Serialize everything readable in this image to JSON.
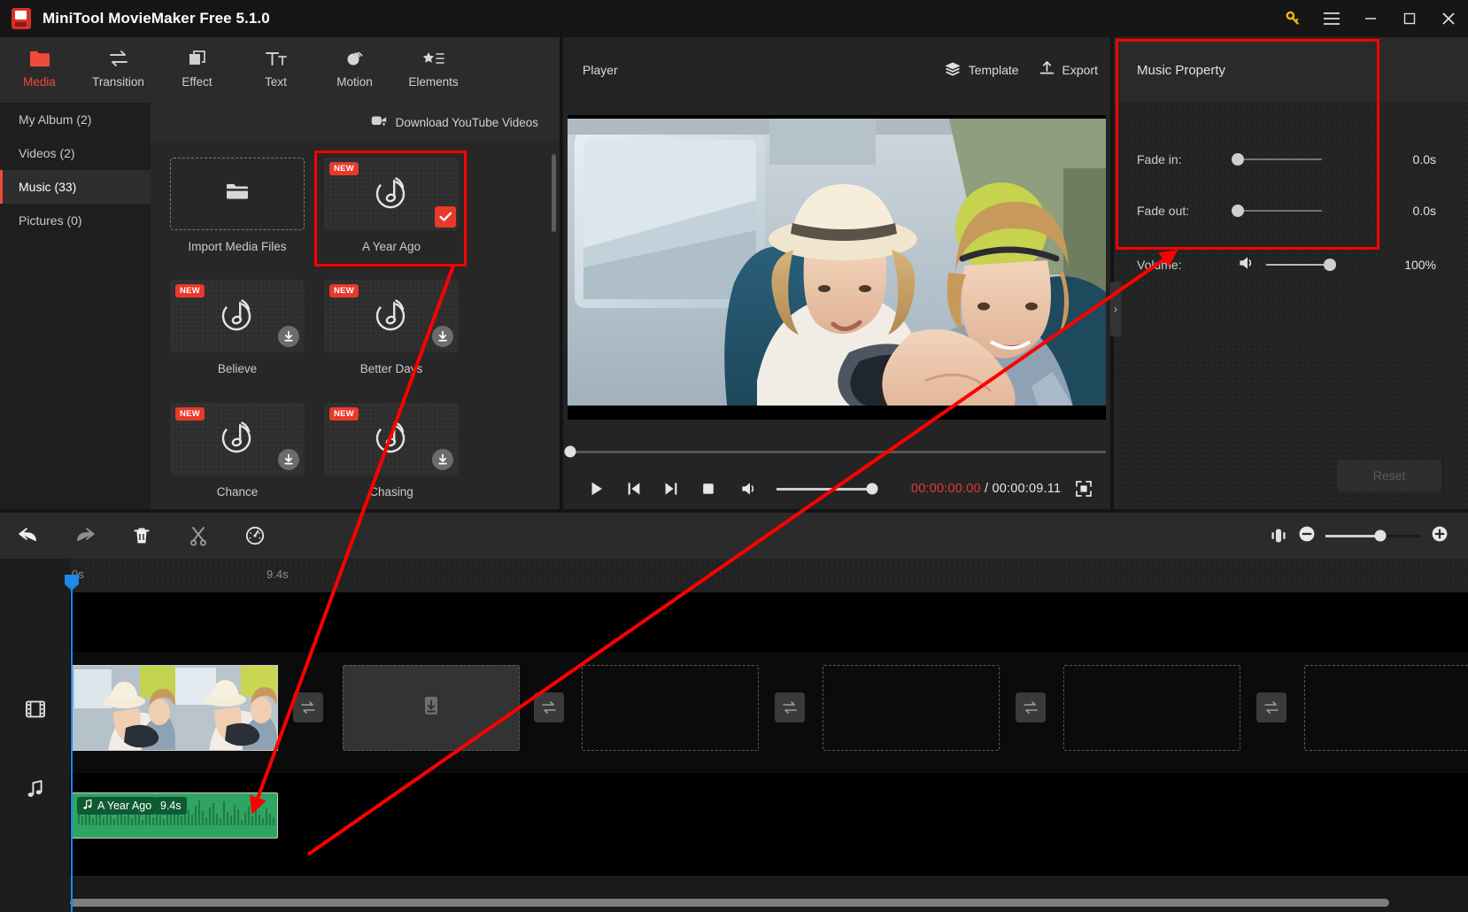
{
  "window": {
    "title": "MiniTool MovieMaker Free 5.1.0",
    "controls": {
      "key": "key-icon",
      "menu": "hamburger-icon",
      "minimize": "—",
      "maximize": "▢",
      "close": "✕"
    }
  },
  "tabs": [
    {
      "label": "Media",
      "icon": "folder-icon",
      "active": true
    },
    {
      "label": "Transition",
      "icon": "transition-icon",
      "active": false
    },
    {
      "label": "Effect",
      "icon": "effect-icon",
      "active": false
    },
    {
      "label": "Text",
      "icon": "text-icon",
      "active": false
    },
    {
      "label": "Motion",
      "icon": "motion-icon",
      "active": false
    },
    {
      "label": "Elements",
      "icon": "elements-icon",
      "active": false
    }
  ],
  "sidebar": {
    "items": [
      {
        "label": "My Album (2)",
        "active": false
      },
      {
        "label": "Videos (2)",
        "active": false
      },
      {
        "label": "Music (33)",
        "active": true
      },
      {
        "label": "Pictures (0)",
        "active": false
      }
    ]
  },
  "media": {
    "download_youtube_label": "Download YouTube Videos",
    "import_label": "Import Media Files",
    "items": [
      {
        "label": "A Year Ago",
        "badge": "NEW",
        "state": "selected"
      },
      {
        "label": "Believe",
        "badge": "NEW",
        "state": "download"
      },
      {
        "label": "Better Days",
        "badge": "NEW",
        "state": "download"
      },
      {
        "label": "Chance",
        "badge": "NEW",
        "state": "download"
      },
      {
        "label": "Chasing",
        "badge": "NEW",
        "state": "download"
      }
    ]
  },
  "player": {
    "title": "Player",
    "template_label": "Template",
    "export_label": "Export",
    "current_time": "00:00:00.00",
    "separator": " / ",
    "total_time": "00:00:09.11",
    "volume_percent": 100,
    "seek_position_percent": 0
  },
  "property": {
    "title": "Music Property",
    "rows": [
      {
        "label": "Fade in:",
        "value": "0.0s",
        "knob_percent": 0
      },
      {
        "label": "Fade out:",
        "value": "0.0s",
        "knob_percent": 0
      },
      {
        "label": "Volume:",
        "value": "100%",
        "knob_percent": 100
      }
    ],
    "reset_label": "Reset"
  },
  "timeline": {
    "toolbar": [
      {
        "name": "undo-icon"
      },
      {
        "name": "redo-icon"
      },
      {
        "name": "delete-icon"
      },
      {
        "name": "split-icon"
      },
      {
        "name": "speed-icon"
      }
    ],
    "zoom": {
      "out_label": "−",
      "in_label": "+",
      "fill_percent": 57
    },
    "ruler": {
      "start_label": "0s",
      "end_label": "9.4s"
    },
    "video_clip": {
      "label": ""
    },
    "music_clip": {
      "name": "A Year Ago",
      "duration": "9.4s"
    }
  },
  "colors": {
    "accent_red": "#ef4a3a",
    "badge_red": "#e8392b",
    "annotation_red": "#ff0000",
    "music_green": "#2fa463",
    "playhead_blue": "#1c8ae8",
    "key_yellow": "#f2b705"
  }
}
